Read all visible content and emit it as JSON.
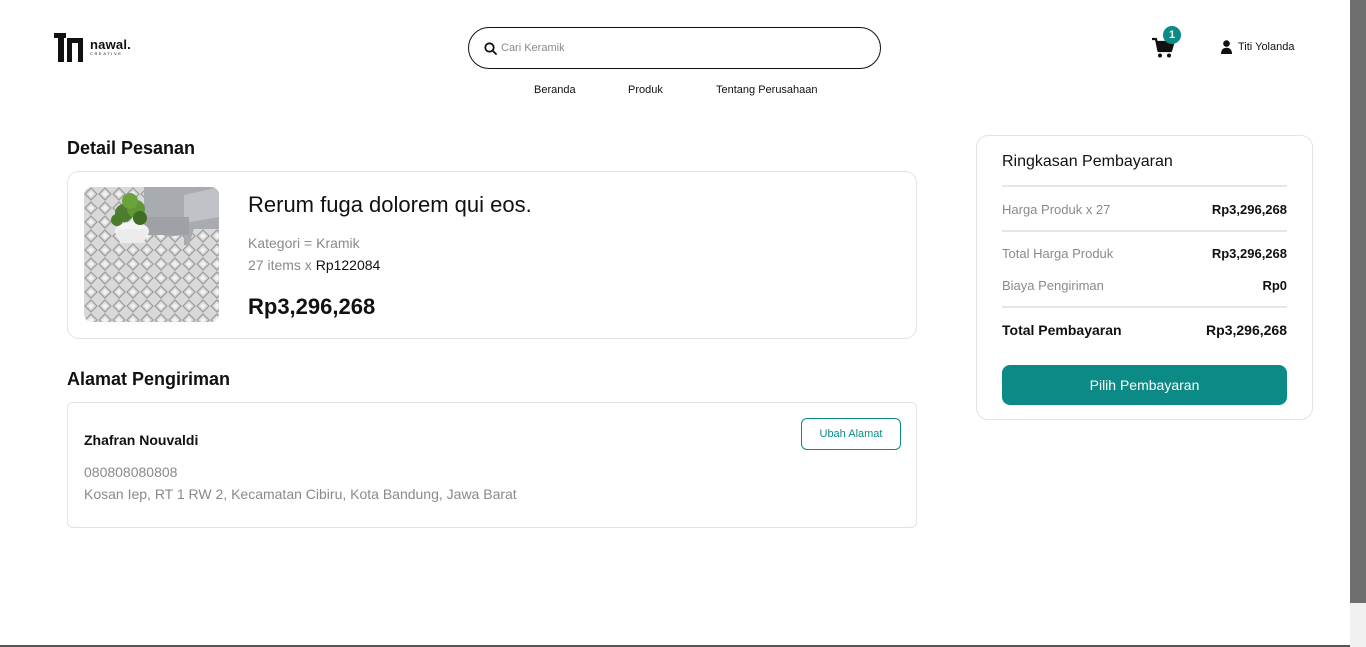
{
  "header": {
    "logo": {
      "word": "nawal.",
      "sub": "CREATIVE"
    },
    "search": {
      "placeholder": "Cari Keramik",
      "value": ""
    },
    "nav": [
      {
        "label": "Beranda"
      },
      {
        "label": "Produk"
      },
      {
        "label": "Tentang Perusahaan"
      }
    ],
    "cart": {
      "count": "1",
      "icon": "cart-icon"
    },
    "user": {
      "name": "Titi Yolanda",
      "icon": "user-icon"
    }
  },
  "order": {
    "title": "Detail Pesanan",
    "product": {
      "name": "Rerum fuga dolorem qui eos.",
      "category": "Kategori = Kramik",
      "qty_text": "27 items x ",
      "unit_price": "Rp122084",
      "total": "Rp3,296,268"
    }
  },
  "shipping": {
    "title": "Alamat Pengiriman",
    "name": "Zhafran Nouvaldi",
    "phone": "080808080808",
    "address": "Kosan Iep, RT 1 RW 2, Kecamatan Cibiru, Kota Bandung, Jawa Barat",
    "change_label": "Ubah Alamat"
  },
  "summary": {
    "title": "Ringkasan Pembayaran",
    "rows": [
      {
        "label": "Harga Produk x 27",
        "value": "Rp3,296,268"
      },
      {
        "label": "Total Harga Produk",
        "value": "Rp3,296,268"
      },
      {
        "label": "Biaya Pengiriman",
        "value": "Rp0"
      }
    ],
    "total_label": "Total Pembayaran",
    "total_value": "Rp3,296,268",
    "pay_label": "Pilih Pembayaran"
  },
  "colors": {
    "accent": "#0c8a86",
    "text": "#111111",
    "muted": "#8a8a8a",
    "border": "#e3e3e3"
  }
}
